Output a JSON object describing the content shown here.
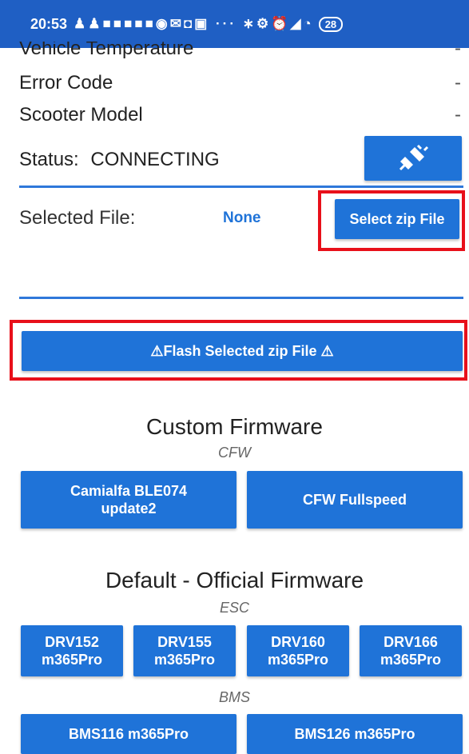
{
  "status_bar": {
    "time": "20:53",
    "icons": "♟♟■■■■■◉✉◘▣ ··· ∗⚙⏰◢◔",
    "battery": "28"
  },
  "info_rows": [
    {
      "label": "Vehicle Temperature",
      "value": "-"
    },
    {
      "label": "Error Code",
      "value": "-"
    },
    {
      "label": "Scooter Model",
      "value": "-"
    }
  ],
  "status": {
    "label": "Status:",
    "value": "CONNECTING",
    "connect_icon": "plug-connect-icon"
  },
  "file": {
    "label": "Selected File:",
    "value": "None",
    "select_button": "Select zip File"
  },
  "flash_button": "⚠Flash Selected zip File ⚠",
  "custom_firmware": {
    "title": "Custom Firmware",
    "subtitle": "CFW",
    "buttons": [
      {
        "line1": "Camialfa BLE074",
        "line2": "update2"
      },
      {
        "line1": "CFW Fullspeed",
        "line2": ""
      }
    ]
  },
  "official_firmware": {
    "title": "Default - Official Firmware",
    "esc_label": "ESC",
    "esc_buttons": [
      {
        "line1": "DRV152",
        "line2": "m365Pro"
      },
      {
        "line1": "DRV155",
        "line2": "m365Pro"
      },
      {
        "line1": "DRV160",
        "line2": "m365Pro"
      },
      {
        "line1": "DRV166",
        "line2": "m365Pro"
      }
    ],
    "bms_label": "BMS",
    "bms_buttons": [
      {
        "label": "BMS116 m365Pro"
      },
      {
        "label": "BMS126 m365Pro"
      }
    ]
  },
  "colors": {
    "accent": "#1f73d8",
    "highlight": "#e8101a",
    "status_bar": "#1f5fc4"
  }
}
